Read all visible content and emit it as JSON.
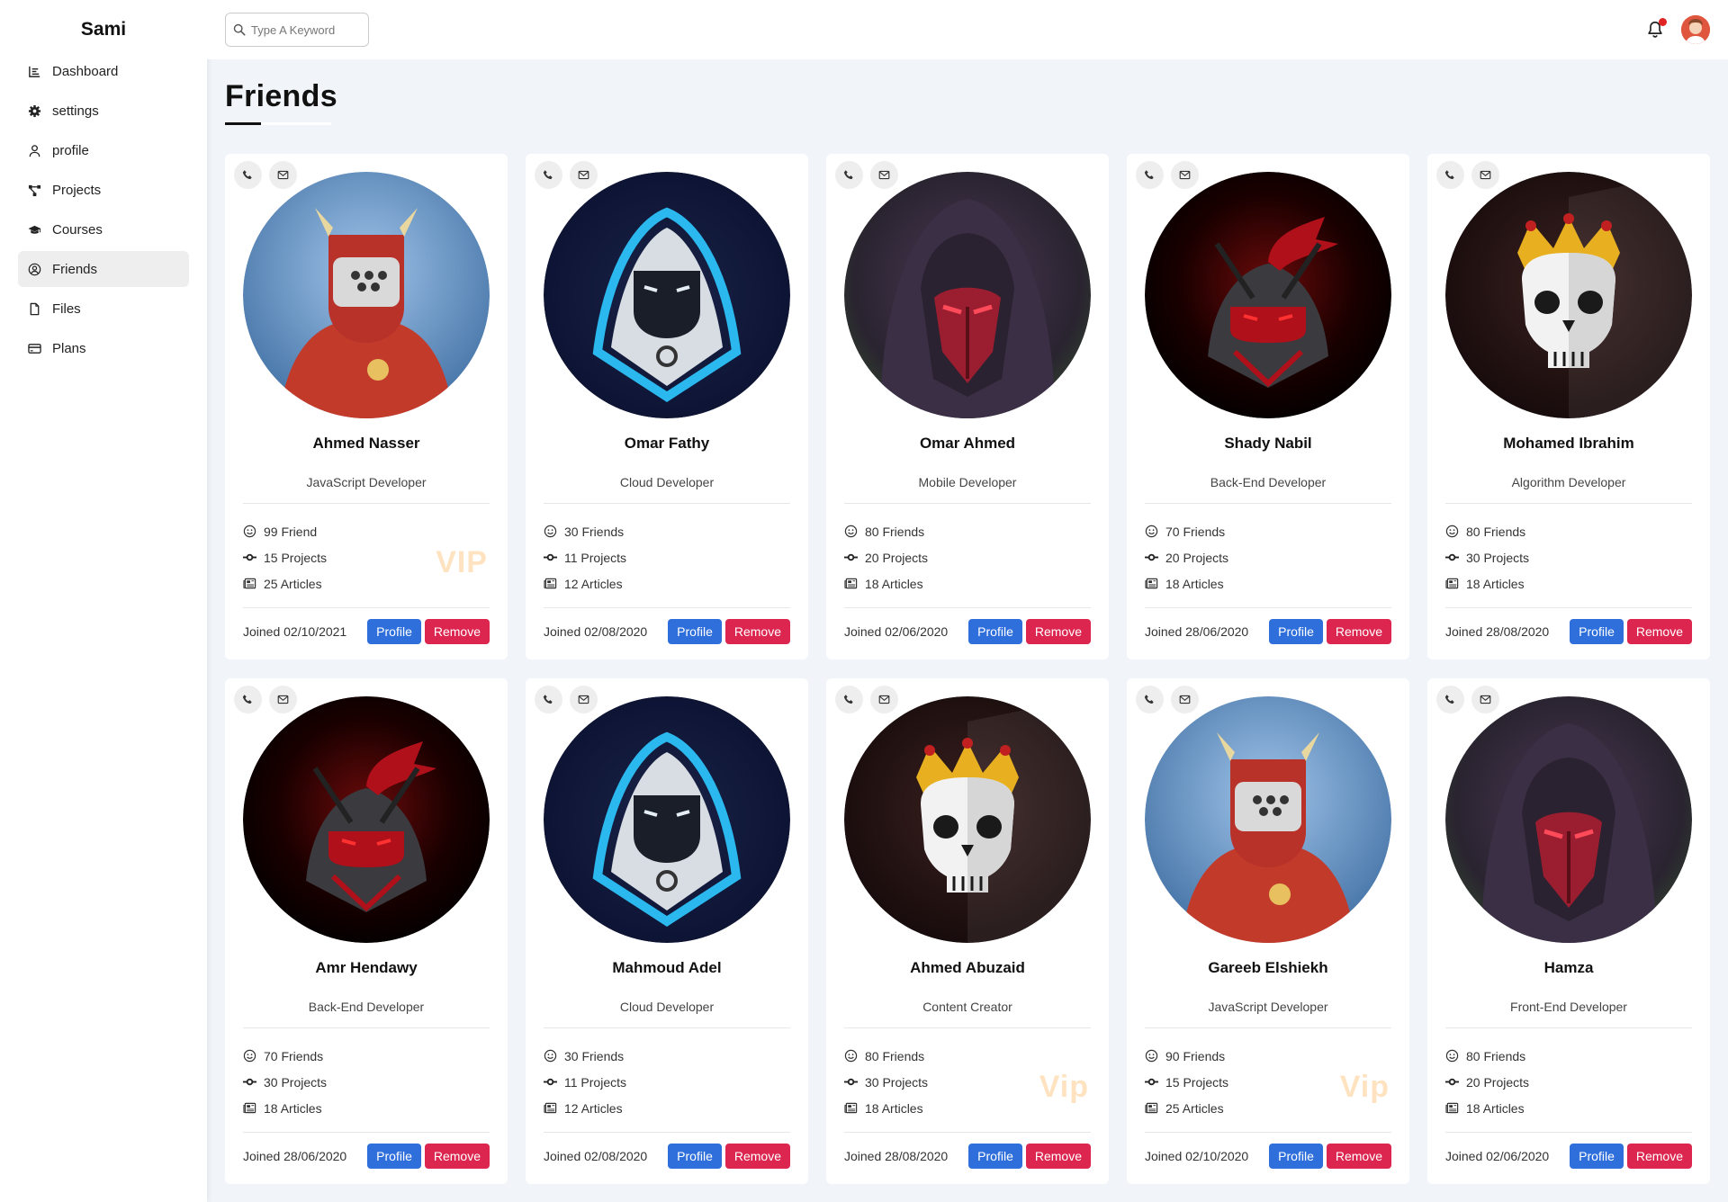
{
  "sidebar": {
    "brand": "Sami",
    "items": [
      {
        "label": "Dashboard",
        "icon": "chart-line-icon"
      },
      {
        "label": "settings",
        "icon": "gear-icon"
      },
      {
        "label": "profile",
        "icon": "user-icon"
      },
      {
        "label": "Projects",
        "icon": "diagram-project-icon"
      },
      {
        "label": "Courses",
        "icon": "graduation-cap-icon"
      },
      {
        "label": "Friends",
        "icon": "circle-user-icon",
        "active": true
      },
      {
        "label": "Files",
        "icon": "file-icon"
      },
      {
        "label": "Plans",
        "icon": "credit-card-icon"
      }
    ]
  },
  "topbar": {
    "search_placeholder": "Type A Keyword",
    "has_notification": true
  },
  "page": {
    "title": "Friends"
  },
  "colors": {
    "profile_button": "#2f6fdb",
    "remove_button": "#dc2650",
    "vip": "#ffd8a8"
  },
  "friends": [
    {
      "name": "Ahmed Nasser",
      "job": "JavaScript Developer",
      "friends": "99 Friend",
      "projects": "15 Projects",
      "articles": "25 Articles",
      "joined": "Joined 02/10/2021",
      "vip": "VIP",
      "avatar": "knight"
    },
    {
      "name": "Omar Fathy",
      "job": "Cloud Developer",
      "friends": "30 Friends",
      "projects": "11 Projects",
      "articles": "12 Articles",
      "joined": "Joined 02/08/2020",
      "vip": "",
      "avatar": "ninja-blue"
    },
    {
      "name": "Omar Ahmed",
      "job": "Mobile Developer",
      "friends": "80 Friends",
      "projects": "20 Projects",
      "articles": "18 Articles",
      "joined": "Joined 02/06/2020",
      "vip": "",
      "avatar": "hood"
    },
    {
      "name": "Shady Nabil",
      "job": "Back-End Developer",
      "friends": "70 Friends",
      "projects": "20 Projects",
      "articles": "18 Articles",
      "joined": "Joined 28/06/2020",
      "vip": "",
      "avatar": "ninja-red"
    },
    {
      "name": "Mohamed Ibrahim",
      "job": "Algorithm Developer",
      "friends": "80 Friends",
      "projects": "30 Projects",
      "articles": "18 Articles",
      "joined": "Joined 28/08/2020",
      "vip": "",
      "avatar": "skull"
    },
    {
      "name": "Amr Hendawy",
      "job": "Back-End Developer",
      "friends": "70 Friends",
      "projects": "30 Projects",
      "articles": "18 Articles",
      "joined": "Joined 28/06/2020",
      "vip": "",
      "avatar": "ninja-red"
    },
    {
      "name": "Mahmoud Adel",
      "job": "Cloud Developer",
      "friends": "30 Friends",
      "projects": "11 Projects",
      "articles": "12 Articles",
      "joined": "Joined 02/08/2020",
      "vip": "",
      "avatar": "ninja-blue"
    },
    {
      "name": "Ahmed Abuzaid",
      "job": "Content Creator",
      "friends": "80 Friends",
      "projects": "30 Projects",
      "articles": "18 Articles",
      "joined": "Joined 28/08/2020",
      "vip": "Vip",
      "avatar": "skull"
    },
    {
      "name": "Gareeb Elshiekh",
      "job": "JavaScript Developer",
      "friends": "90 Friends",
      "projects": "15 Projects",
      "articles": "25 Articles",
      "joined": "Joined 02/10/2020",
      "vip": "Vip",
      "avatar": "knight"
    },
    {
      "name": "Hamza",
      "job": "Front-End Developer",
      "friends": "80 Friends",
      "projects": "20 Projects",
      "articles": "18 Articles",
      "joined": "Joined 02/06/2020",
      "vip": "",
      "avatar": "hood"
    }
  ],
  "buttons": {
    "profile": "Profile",
    "remove": "Remove"
  }
}
